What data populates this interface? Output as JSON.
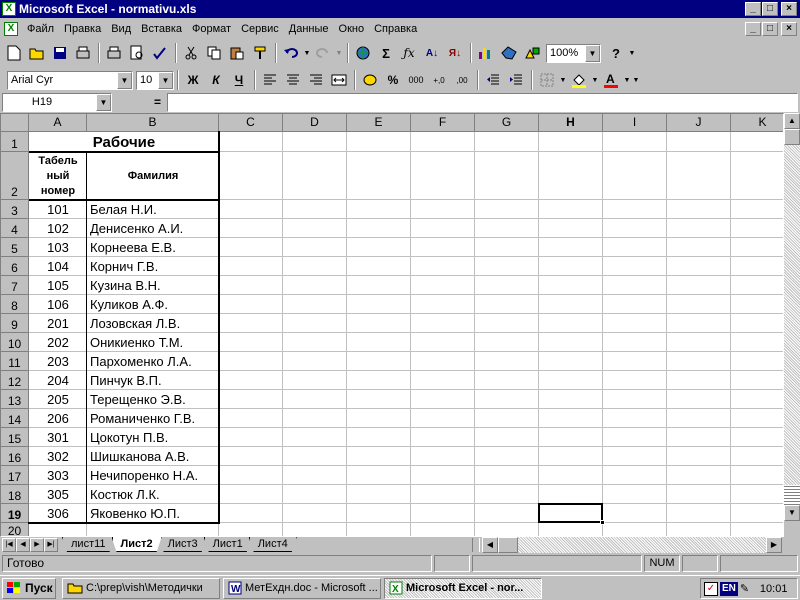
{
  "window": {
    "title": "Microsoft Excel - normativu.xls",
    "min": "_",
    "max": "□",
    "close": "×"
  },
  "menu": [
    "Файл",
    "Правка",
    "Вид",
    "Вставка",
    "Формат",
    "Сервис",
    "Данные",
    "Окно",
    "Справка"
  ],
  "toolbar1": {
    "zoom": "100%"
  },
  "toolbar2": {
    "font": "Arial Cyr",
    "size": "10",
    "bold": "Ж",
    "italic": "К",
    "underline": "Ч",
    "percent": "%",
    "thousands": "000"
  },
  "formula_bar": {
    "name_box": "H19",
    "equals": "=",
    "value": ""
  },
  "columns": [
    "A",
    "B",
    "C",
    "D",
    "E",
    "F",
    "G",
    "H",
    "I",
    "J",
    "K"
  ],
  "rows": [
    "1",
    "2",
    "3",
    "4",
    "5",
    "6",
    "7",
    "8",
    "9",
    "10",
    "11",
    "12",
    "13",
    "14",
    "15",
    "16",
    "17",
    "18",
    "19",
    "20"
  ],
  "sheet": {
    "title": "Рабочие",
    "header_num": "Табель ный номер",
    "header_name": "Фамилия",
    "records": [
      {
        "num": "101",
        "name": "Белая Н.И."
      },
      {
        "num": "102",
        "name": "Денисенко А.И."
      },
      {
        "num": "103",
        "name": "Корнеева Е.В."
      },
      {
        "num": "104",
        "name": "Корнич Г.В."
      },
      {
        "num": "105",
        "name": "Кузина В.Н."
      },
      {
        "num": "106",
        "name": "Куликов А.Ф."
      },
      {
        "num": "201",
        "name": "Лозовская Л.В."
      },
      {
        "num": "202",
        "name": "Оникиенко Т.М."
      },
      {
        "num": "203",
        "name": "Пархоменко Л.А."
      },
      {
        "num": "204",
        "name": "Пинчук В.П."
      },
      {
        "num": "205",
        "name": "Терещенко Э.В."
      },
      {
        "num": "206",
        "name": "Романиченко Г.В."
      },
      {
        "num": "301",
        "name": "Цокотун П.В."
      },
      {
        "num": "302",
        "name": "Шишканова А.В."
      },
      {
        "num": "303",
        "name": "Нечипоренко Н.А."
      },
      {
        "num": "305",
        "name": "Костюк Л.К."
      },
      {
        "num": "306",
        "name": "Яковенко Ю.П."
      }
    ]
  },
  "active_cell": "H19",
  "tabs": [
    "лист11",
    "Лист2",
    "Лист3",
    "Лист1",
    "Лист4"
  ],
  "active_tab": "Лист2",
  "status": {
    "ready": "Готово",
    "num": "NUM"
  },
  "taskbar": {
    "start": "Пуск",
    "tasks": [
      "C:\\prep\\vish\\Методички",
      "МетЕхдн.doc - Microsoft ...",
      "Microsoft Excel - nor..."
    ],
    "lang": "EN",
    "clock": "10:01"
  }
}
